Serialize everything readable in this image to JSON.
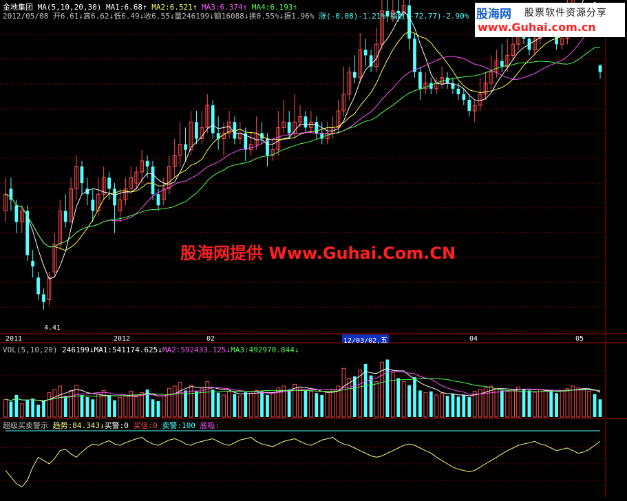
{
  "header": {
    "stock_name": "金地集团",
    "ma_params": "MA(5,10,20,30)",
    "ma1": "MA1:6.68",
    "ma2": "MA2:6.521",
    "ma3": "MA3:6.374",
    "ma4": "MA4:6.193",
    "date": "2012/05/08",
    "open": "开6.61",
    "high": "高6.62",
    "low": "低6.49",
    "close": "收6.55",
    "volume": "量246199",
    "amount": "额16088",
    "turnover": "换0.55%",
    "amplitude": "振1.96%",
    "change": "涨(-0.08)-1.21%",
    "index": "指数(-72.77)-2.90%"
  },
  "logo": {
    "name": "股海网",
    "slogan": "股票软件资源分享",
    "url": "www.Guhai.com.cn"
  },
  "watermark": "股海网提供 Www.Guhai.Com.CN",
  "axis": {
    "ticks": [
      "2011",
      "2012",
      "02",
      "04",
      "05"
    ],
    "selected": "12/03/02,五",
    "low_label": "4.41"
  },
  "volume_header": {
    "title": "VOL(5,10,20)",
    "vol": "246199",
    "ma1": "MA1:541174.625",
    "ma2": "MA2:592433.125",
    "ma3": "MA3:492970.844"
  },
  "indicator_header": {
    "title": "超级买卖警示",
    "trend": "趋势:84.343",
    "buy_alert": "买警:0",
    "buy_signal": "买信:0",
    "sell_alert": "卖警:100",
    "bottom": "底吸:"
  },
  "colors": {
    "up": "#ff5050",
    "down": "#54ffff",
    "ma1": "#ffffff",
    "ma2": "#ffff54",
    "ma3": "#ff54ff",
    "ma4": "#54ff54",
    "grid": "#8b0000",
    "trend": "#ffff80",
    "alert": "#54ffff"
  },
  "chart_data": {
    "type": "candlestick",
    "price_range": [
      4.2,
      7.0
    ],
    "candles": [
      [
        5.3,
        5.45,
        5.6,
        5.2
      ],
      [
        5.5,
        5.4,
        5.6,
        5.3
      ],
      [
        5.35,
        5.2,
        5.4,
        5.1
      ],
      [
        5.2,
        5.3,
        5.35,
        5.1
      ],
      [
        5.3,
        4.9,
        5.35,
        4.85
      ],
      [
        4.85,
        4.8,
        4.95,
        4.7
      ],
      [
        4.7,
        4.55,
        4.75,
        4.5
      ],
      [
        4.55,
        4.48,
        4.6,
        4.41
      ],
      [
        4.5,
        4.7,
        4.75,
        4.45
      ],
      [
        4.75,
        5.0,
        5.1,
        4.7
      ],
      [
        5.0,
        5.3,
        5.4,
        4.95
      ],
      [
        5.3,
        5.2,
        5.45,
        5.15
      ],
      [
        5.2,
        5.5,
        5.6,
        5.2
      ],
      [
        5.5,
        5.7,
        5.8,
        5.4
      ],
      [
        5.7,
        5.55,
        5.75,
        5.45
      ],
      [
        5.5,
        5.45,
        5.6,
        5.35
      ],
      [
        5.4,
        5.3,
        5.5,
        5.2
      ],
      [
        5.3,
        5.45,
        5.6,
        5.25
      ],
      [
        5.45,
        5.6,
        5.7,
        5.4
      ],
      [
        5.6,
        5.5,
        5.65,
        5.4
      ],
      [
        5.5,
        5.35,
        5.55,
        5.1
      ],
      [
        5.3,
        5.4,
        5.5,
        5.2
      ],
      [
        5.4,
        5.5,
        5.6,
        5.35
      ],
      [
        5.5,
        5.6,
        5.7,
        5.45
      ],
      [
        5.55,
        5.65,
        5.7,
        5.5
      ],
      [
        5.65,
        5.75,
        5.85,
        5.55
      ],
      [
        5.75,
        5.7,
        5.8,
        5.6
      ],
      [
        5.7,
        5.45,
        5.75,
        5.4
      ],
      [
        5.45,
        5.35,
        5.5,
        5.3
      ],
      [
        5.4,
        5.5,
        5.6,
        5.35
      ],
      [
        5.5,
        5.7,
        5.8,
        5.45
      ],
      [
        5.7,
        5.8,
        5.95,
        5.6
      ],
      [
        5.8,
        5.9,
        6.1,
        5.7
      ],
      [
        5.9,
        5.85,
        6.05,
        5.75
      ],
      [
        5.85,
        6.1,
        6.2,
        5.8
      ],
      [
        6.1,
        5.95,
        6.2,
        5.9
      ],
      [
        5.95,
        6.05,
        6.2,
        5.9
      ],
      [
        6.05,
        6.25,
        6.35,
        6.0
      ],
      [
        6.25,
        6.0,
        6.3,
        5.95
      ],
      [
        6.0,
        5.95,
        6.15,
        5.85
      ],
      [
        5.95,
        6.0,
        6.1,
        5.8
      ],
      [
        6.0,
        6.1,
        6.2,
        5.95
      ],
      [
        6.1,
        5.95,
        6.15,
        5.9
      ],
      [
        5.95,
        6.0,
        6.1,
        5.9
      ],
      [
        6.0,
        5.85,
        6.05,
        5.75
      ],
      [
        5.85,
        5.9,
        6.0,
        5.8
      ],
      [
        5.9,
        6.0,
        6.15,
        5.85
      ],
      [
        6.0,
        5.95,
        6.1,
        5.9
      ],
      [
        5.95,
        5.8,
        6.0,
        5.7
      ],
      [
        5.8,
        5.85,
        5.95,
        5.75
      ],
      [
        5.85,
        6.05,
        6.2,
        5.8
      ],
      [
        6.05,
        6.1,
        6.3,
        6.0
      ],
      [
        6.1,
        6.0,
        6.2,
        5.95
      ],
      [
        6.0,
        6.1,
        6.35,
        5.95
      ],
      [
        6.1,
        6.15,
        6.25,
        6.05
      ],
      [
        6.15,
        6.05,
        6.2,
        6.0
      ],
      [
        6.05,
        6.1,
        6.2,
        6.0
      ],
      [
        6.1,
        6.0,
        6.15,
        5.95
      ],
      [
        6.0,
        5.95,
        6.1,
        5.9
      ],
      [
        5.95,
        6.0,
        6.1,
        5.9
      ],
      [
        6.0,
        6.05,
        6.15,
        5.95
      ],
      [
        6.05,
        6.2,
        6.3,
        6.0
      ],
      [
        6.2,
        6.35,
        6.6,
        6.15
      ],
      [
        6.35,
        6.55,
        6.6,
        6.3
      ],
      [
        6.55,
        6.5,
        6.7,
        6.45
      ],
      [
        6.5,
        6.75,
        6.9,
        6.45
      ],
      [
        6.75,
        6.7,
        6.85,
        6.6
      ],
      [
        6.7,
        6.6,
        6.75,
        6.55
      ],
      [
        6.6,
        6.8,
        6.95,
        6.55
      ],
      [
        6.8,
        7.1,
        7.2,
        6.75
      ],
      [
        7.1,
        7.05,
        7.25,
        7.0
      ],
      [
        7.05,
        7.1,
        7.2,
        7.0
      ],
      [
        7.1,
        7.08,
        7.2,
        7.0
      ],
      [
        7.08,
        7.15,
        7.25,
        7.05
      ],
      [
        7.15,
        6.85,
        7.2,
        6.75
      ],
      [
        6.85,
        6.55,
        6.9,
        6.5
      ],
      [
        6.55,
        6.4,
        6.6,
        6.3
      ],
      [
        6.4,
        6.45,
        6.55,
        6.35
      ],
      [
        6.45,
        6.4,
        6.5,
        6.35
      ],
      [
        6.4,
        6.45,
        6.5,
        6.35
      ],
      [
        6.45,
        6.5,
        6.6,
        6.4
      ],
      [
        6.5,
        6.45,
        6.55,
        6.4
      ],
      [
        6.45,
        6.4,
        6.5,
        6.35
      ],
      [
        6.4,
        6.35,
        6.45,
        6.3
      ],
      [
        6.35,
        6.3,
        6.4,
        6.25
      ],
      [
        6.3,
        6.2,
        6.35,
        6.15
      ],
      [
        6.2,
        6.25,
        6.3,
        6.1
      ],
      [
        6.25,
        6.35,
        6.5,
        6.2
      ],
      [
        6.35,
        6.45,
        6.55,
        6.3
      ],
      [
        6.45,
        6.55,
        6.7,
        6.4
      ],
      [
        6.55,
        6.65,
        6.75,
        6.5
      ],
      [
        6.65,
        6.6,
        6.8,
        6.55
      ],
      [
        6.6,
        6.7,
        6.85,
        6.55
      ],
      [
        6.7,
        6.8,
        6.95,
        6.65
      ],
      [
        6.8,
        6.9,
        7.05,
        6.75
      ],
      [
        6.9,
        6.85,
        7.0,
        6.8
      ],
      [
        6.85,
        6.75,
        6.9,
        6.7
      ],
      [
        6.75,
        6.85,
        7.0,
        6.7
      ],
      [
        6.85,
        6.95,
        7.05,
        6.8
      ],
      [
        6.95,
        7.0,
        7.1,
        6.9
      ],
      [
        7.0,
        6.95,
        7.1,
        6.9
      ],
      [
        6.95,
        6.8,
        7.0,
        6.75
      ],
      [
        6.8,
        6.85,
        6.95,
        6.75
      ],
      [
        6.85,
        7.05,
        7.2,
        6.8
      ],
      [
        7.05,
        7.25,
        7.35,
        7.0
      ],
      [
        7.25,
        7.4,
        7.55,
        7.2
      ],
      [
        7.4,
        7.5,
        7.6,
        7.35
      ],
      [
        7.5,
        7.55,
        7.65,
        7.45
      ],
      [
        7.55,
        7.45,
        7.6,
        7.4
      ],
      [
        6.61,
        6.55,
        6.62,
        6.49
      ]
    ],
    "volume": [
      40,
      35,
      50,
      30,
      38,
      42,
      28,
      36,
      55,
      62,
      70,
      48,
      60,
      72,
      50,
      45,
      40,
      52,
      60,
      48,
      38,
      44,
      50,
      58,
      46,
      55,
      62,
      40,
      36,
      48,
      65,
      70,
      78,
      60,
      72,
      58,
      64,
      80,
      62,
      55,
      50,
      58,
      52,
      48,
      56,
      54,
      60,
      58,
      50,
      54,
      66,
      70,
      62,
      74,
      68,
      60,
      58,
      54,
      50,
      56,
      62,
      70,
      110,
      88,
      92,
      106,
      120,
      94,
      80,
      124,
      130,
      100,
      88,
      80,
      72,
      90,
      60,
      55,
      58,
      50,
      54,
      48,
      52,
      46,
      50,
      45,
      58,
      62,
      66,
      70,
      64,
      60,
      58,
      62,
      68,
      64,
      60,
      56,
      62,
      60,
      58,
      54,
      60,
      64,
      70,
      66,
      62,
      58,
      52,
      40
    ],
    "vol_max": 140,
    "trend": [
      40,
      30,
      20,
      15,
      25,
      45,
      60,
      55,
      50,
      58,
      70,
      72,
      65,
      60,
      68,
      75,
      80,
      78,
      82,
      85,
      80,
      78,
      82,
      85,
      88,
      90,
      84,
      80,
      78,
      82,
      86,
      88,
      85,
      80,
      78,
      82,
      84,
      86,
      88,
      84,
      80,
      78,
      82,
      86,
      88,
      90,
      84,
      80,
      78,
      76,
      80,
      84,
      86,
      88,
      84,
      80,
      78,
      82,
      86,
      88,
      90,
      84,
      80,
      78,
      74,
      70,
      66,
      62,
      60,
      62,
      66,
      70,
      74,
      78,
      80,
      78,
      74,
      70,
      66,
      60,
      55,
      50,
      45,
      42,
      40,
      38,
      40,
      45,
      50,
      55,
      60,
      65,
      70,
      74,
      78,
      80,
      82,
      84,
      80,
      78,
      74,
      70,
      72,
      74,
      70,
      66,
      68,
      72,
      78,
      84
    ],
    "alerts": [
      100,
      100,
      100,
      100,
      100,
      100,
      100,
      100,
      100,
      100,
      100,
      100,
      100,
      100,
      100,
      100,
      100,
      100,
      100,
      100,
      100,
      100,
      100,
      100,
      100,
      100,
      100,
      100,
      100,
      100,
      100,
      100,
      100,
      100,
      100,
      100,
      100,
      100,
      100,
      100,
      100,
      100,
      100,
      100,
      100,
      100,
      100,
      100,
      100,
      100,
      100,
      100,
      100,
      100,
      100,
      100,
      100,
      100,
      100,
      100,
      100,
      100,
      100,
      100,
      100,
      100,
      100,
      100,
      100,
      100,
      100,
      100,
      100,
      100,
      100,
      100,
      100,
      100,
      100,
      100,
      100,
      100,
      100,
      100,
      100,
      100,
      100,
      100,
      100,
      100,
      100,
      100,
      100,
      100,
      100,
      100,
      100,
      100,
      100,
      100,
      100,
      100,
      100,
      100,
      100,
      100,
      100,
      100,
      100,
      100
    ]
  }
}
